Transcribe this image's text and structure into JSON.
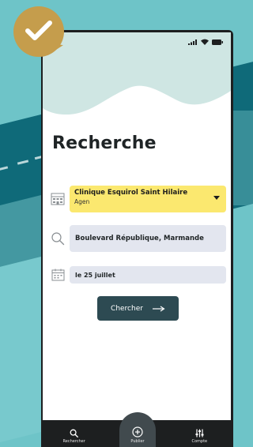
{
  "colors": {
    "background": "#6ec4c8",
    "accent_dark": "#2d4a52",
    "highlight_yellow": "#fbe86f",
    "badge_gold": "#c59d4c"
  },
  "badge": {
    "icon": "checkmark-icon"
  },
  "status_bar": {
    "icons": [
      "signal-icon",
      "wifi-icon",
      "battery-icon"
    ]
  },
  "page": {
    "title": "Recherche"
  },
  "search": {
    "clinic": {
      "icon": "building-icon",
      "name": "Clinique Esquirol Saint Hilaire",
      "city": "Agen"
    },
    "address": {
      "icon": "search-icon",
      "value": "Boulevard République, Marmande"
    },
    "date": {
      "icon": "calendar-icon",
      "value": "le 25 juillet"
    },
    "submit_label": "Chercher"
  },
  "tabbar": {
    "items": [
      {
        "label": "Rechercher",
        "icon": "search-icon"
      },
      {
        "label": "Publier",
        "icon": "plus-circle-icon"
      },
      {
        "label": "Compte",
        "icon": "sliders-icon"
      }
    ]
  }
}
